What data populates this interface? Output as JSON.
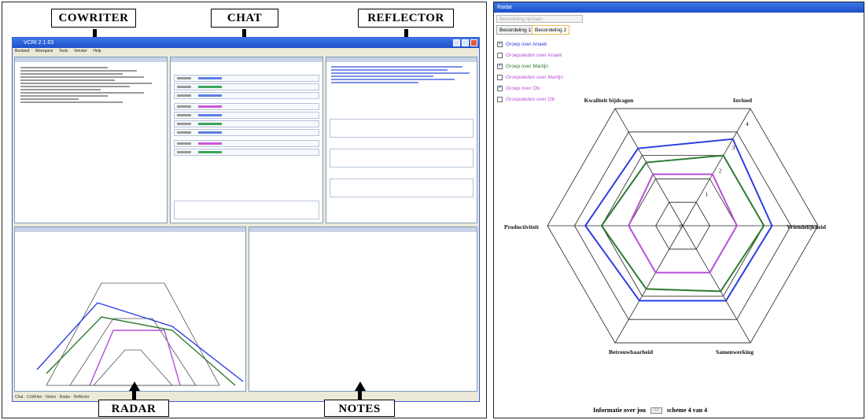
{
  "callouts": {
    "cowriter": "COWRITER",
    "chat": "CHAT",
    "reflector": "REFLECTOR",
    "radar": "RADAR",
    "notes": "NOTES"
  },
  "app": {
    "title": "VCRI 2.1.63",
    "menu": [
      "Bestand",
      "Weergave",
      "Tools",
      "Venster",
      "Help"
    ],
    "status_items": [
      "Chat",
      "CoWriter",
      "Notes",
      "Radar",
      "Reflector"
    ]
  },
  "radar_window": {
    "title": "Radar",
    "save_button": "Beoordeling opslaan",
    "tabs": [
      "Beoordeling 1",
      "Beoordeling 2"
    ],
    "active_tab": 1,
    "legend": [
      {
        "label": "Groep over Anaek",
        "checked": true,
        "color": "#2b3fe0"
      },
      {
        "label": "Groepsleden over Anaek",
        "checked": false,
        "color": "#b84fd6"
      },
      {
        "label": "Groep over Martijn",
        "checked": true,
        "color": "#2d7a2d"
      },
      {
        "label": "Groepsleden over Martijn",
        "checked": false,
        "color": "#b84fd6"
      },
      {
        "label": "Groep over Ob",
        "checked": true,
        "color": "#b84fd6"
      },
      {
        "label": "Groepsleden over Ob",
        "checked": false,
        "color": "#b84fd6"
      }
    ],
    "axes": [
      "Invloed",
      "Vriendelijkheid",
      "Samenwerking",
      "Betrouwbaarheid",
      "Productiviteit",
      "Kwaliteit bijdragen"
    ],
    "ticks": [
      "0",
      "1",
      "2",
      "3",
      "4"
    ],
    "footer_label": "Informatie over jou",
    "footer_button": "<<",
    "footer_page": "scheme 4 van 4"
  },
  "chart_data": {
    "type": "radar",
    "axes": [
      "Invloed",
      "Vriendelijkheid",
      "Samenwerking",
      "Betrouwbaarheid",
      "Productiviteit",
      "Kwaliteit bijdragen"
    ],
    "range": [
      0,
      5
    ],
    "series": [
      {
        "values": [
          3.7,
          3.3,
          3.2,
          3.2,
          3.6,
          3.3
        ],
        "color": "#2b3fe0"
      },
      {
        "values": [
          3.0,
          3.0,
          2.8,
          2.7,
          3.0,
          2.7
        ],
        "color": "#2d7a2d"
      },
      {
        "values": [
          2.2,
          2.0,
          2.0,
          2.0,
          2.0,
          2.2
        ],
        "color": "#b84fd6"
      }
    ]
  }
}
